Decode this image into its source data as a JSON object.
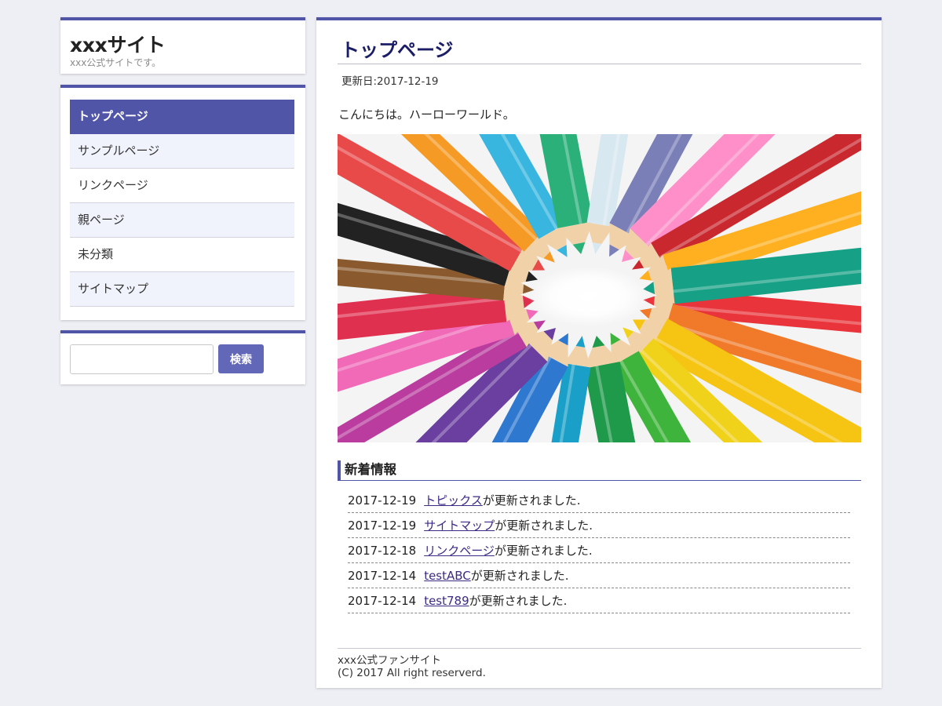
{
  "site": {
    "title": "xxxサイト",
    "description": "xxx公式サイトです。"
  },
  "nav": {
    "items": [
      {
        "label": "トップページ"
      },
      {
        "label": "サンプルページ"
      },
      {
        "label": "リンクページ"
      },
      {
        "label": "親ページ"
      },
      {
        "label": "未分類"
      },
      {
        "label": "サイトマップ"
      }
    ],
    "active_index": 0
  },
  "search": {
    "value": "",
    "placeholder": "",
    "button_label": "検索"
  },
  "main": {
    "title": "トップページ",
    "updated": "更新日:2017-12-19",
    "greeting": "こんにちは。ハーローワールド。",
    "hero_icon": "colored-pencils-image"
  },
  "news": {
    "heading": "新着情報",
    "items": [
      {
        "date": "2017-12-19",
        "link": "トピックス",
        "suffix": "が更新されました."
      },
      {
        "date": "2017-12-19",
        "link": "サイトマップ",
        "suffix": "が更新されました."
      },
      {
        "date": "2017-12-18",
        "link": "リンクページ",
        "suffix": "が更新されました."
      },
      {
        "date": "2017-12-14",
        "link": "testABC",
        "suffix": "が更新されました."
      },
      {
        "date": "2017-12-14",
        "link": "test789",
        "suffix": "が更新されました."
      }
    ]
  },
  "footer": {
    "line1": "xxx公式ファンサイト",
    "line2": "(C) 2017 All right reserverd."
  },
  "colors": {
    "accent": "#5155a8",
    "title": "#1b1e66",
    "link": "#3d2a86",
    "background": "#eeeff5"
  }
}
